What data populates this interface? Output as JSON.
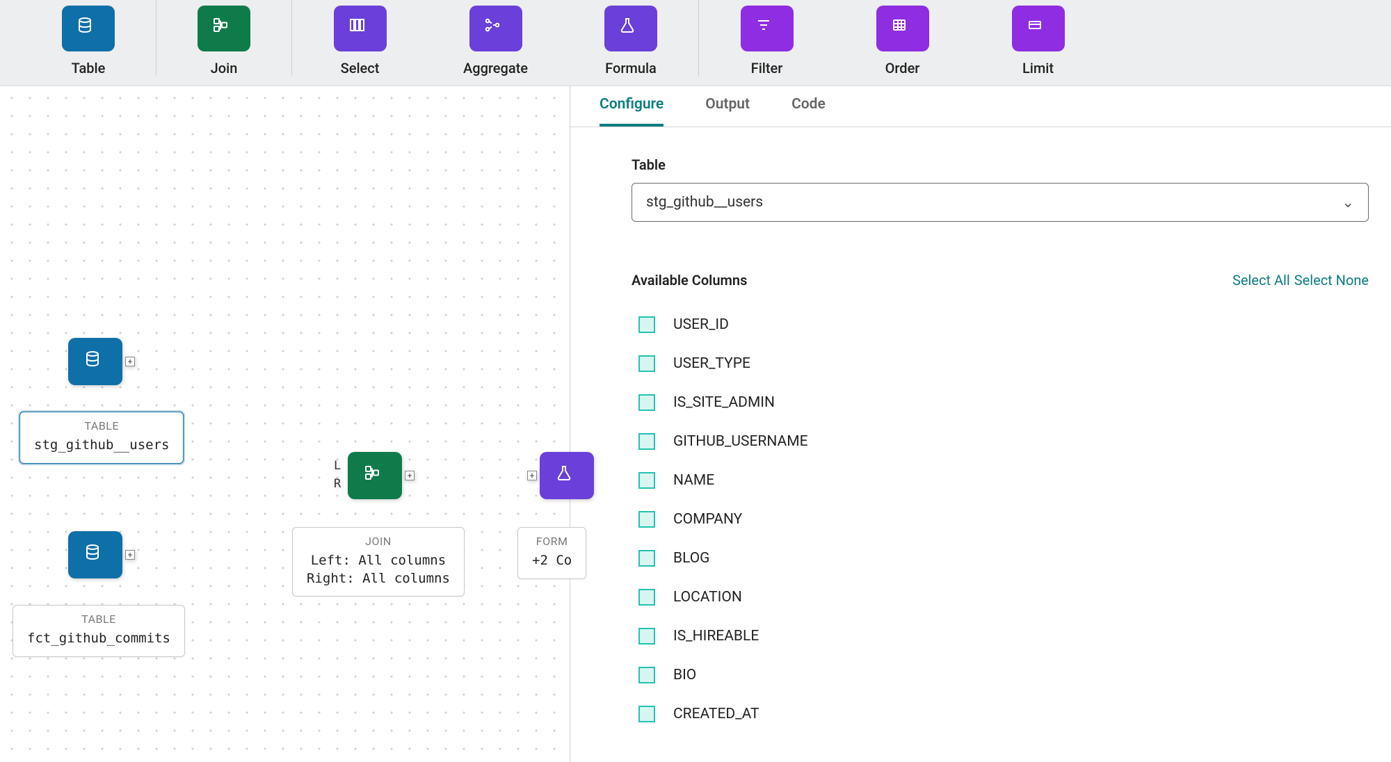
{
  "toolbar": [
    {
      "label": "Table",
      "color": "c-blue",
      "icon": "db"
    },
    {
      "label": "Join",
      "color": "c-green",
      "icon": "join"
    },
    {
      "label": "Select",
      "color": "c-purple",
      "icon": "select"
    },
    {
      "label": "Aggregate",
      "color": "c-purple",
      "icon": "agg"
    },
    {
      "label": "Formula",
      "color": "c-purple",
      "icon": "flask"
    },
    {
      "label": "Filter",
      "color": "c-violet",
      "icon": "filter"
    },
    {
      "label": "Order",
      "color": "c-violet",
      "icon": "order"
    },
    {
      "label": "Limit",
      "color": "c-violet",
      "icon": "limit"
    }
  ],
  "canvas": {
    "node1": {
      "caption": "TABLE",
      "body": "stg_github__users"
    },
    "node2": {
      "caption": "TABLE",
      "body": "fct_github_commits"
    },
    "join": {
      "caption": "JOIN",
      "body": "Left: All columns\nRight: All columns",
      "port_l": "L",
      "port_r": "R"
    },
    "formula": {
      "caption": "FORM",
      "body": "+2 Co"
    },
    "plus": "+"
  },
  "panel": {
    "tabs": {
      "configure": "Configure",
      "output": "Output",
      "code": "Code"
    },
    "table_label": "Table",
    "table_value": "stg_github__users",
    "avail_label": "Available Columns",
    "select_all": "Select All",
    "select_none": "Select None",
    "columns": [
      "USER_ID",
      "USER_TYPE",
      "IS_SITE_ADMIN",
      "GITHUB_USERNAME",
      "NAME",
      "COMPANY",
      "BLOG",
      "LOCATION",
      "IS_HIREABLE",
      "BIO",
      "CREATED_AT"
    ]
  }
}
